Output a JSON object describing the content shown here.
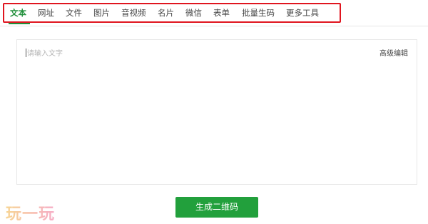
{
  "tabs": [
    {
      "label": "文本",
      "active": true
    },
    {
      "label": "网址"
    },
    {
      "label": "文件"
    },
    {
      "label": "图片"
    },
    {
      "label": "音视频"
    },
    {
      "label": "名片"
    },
    {
      "label": "微信"
    },
    {
      "label": "表单"
    },
    {
      "label": "批量生码"
    },
    {
      "label": "更多工具"
    }
  ],
  "editor": {
    "placeholder": "请输入文字",
    "advanced_edit": "高级编辑"
  },
  "generate_button": "生成二维码",
  "watermark": "玩一玩",
  "colors": {
    "accent": "#1f8f3a",
    "button": "#22a03c",
    "highlight_box": "#e0151f"
  }
}
